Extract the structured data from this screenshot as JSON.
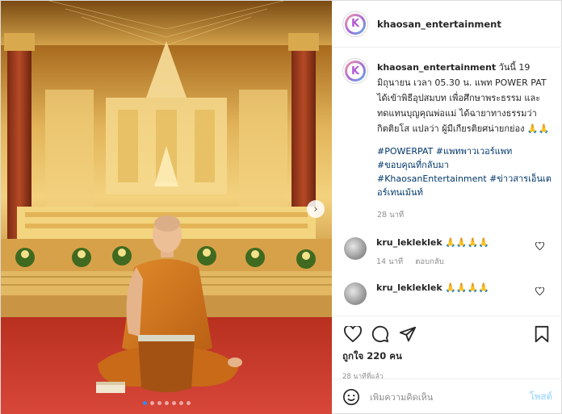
{
  "post": {
    "username": "khaosan_entertainment",
    "avatar_letter": "K",
    "caption_text": "วันนี้ 19 มิถุนายน เวลา 05.30 น. แพท POWER PAT ได้เข้าพิธีอุปสมบท เพื่อศึกษาพระธรรม และทดแทนบุญคุณพ่อแม่ ได้ฉายาทางธรรมว่า กิตติยโส แปลว่า ผู้มีเกียรติยศน่ายกย่อง 🙏🙏",
    "hashtags_line1": "#POWERPAT #แพทพาวเวอร์แพท",
    "hashtags_line2": "#ขอบคุณที่กลับมา",
    "hashtags_line3": "#KhaosanEntertainment #ข่าวสารเอ็นเตอร์เทนเม้นท์",
    "caption_time": "28 นาที",
    "likes": "ถูกใจ 220 คน",
    "posted_ago": "28 นาทีที่แล้ว"
  },
  "comments": [
    {
      "username": "kru_lekleklek",
      "text": "🙏🙏🙏🙏",
      "time": "14 นาที",
      "reply": "ตอบกลับ"
    },
    {
      "username": "kru_lekleklek",
      "text": "🙏🙏🙏🙏"
    }
  ],
  "comment_box": {
    "placeholder": "เพิ่มความคิดเห็น",
    "post_label": "โพสต์"
  },
  "carousel": {
    "slide_count": 7,
    "active_index": 0
  },
  "icons": {
    "like": "heart-icon",
    "comment": "comment-icon",
    "share": "send-icon",
    "save": "bookmark-icon",
    "emoji": "smiley-icon",
    "next": "chevron-right-icon"
  },
  "colors": {
    "link": "#00376b",
    "post_button": "#b2dffc",
    "active_dot": "#2d8cf0",
    "robe": "#d2751e",
    "carpet": "#c8372a"
  }
}
